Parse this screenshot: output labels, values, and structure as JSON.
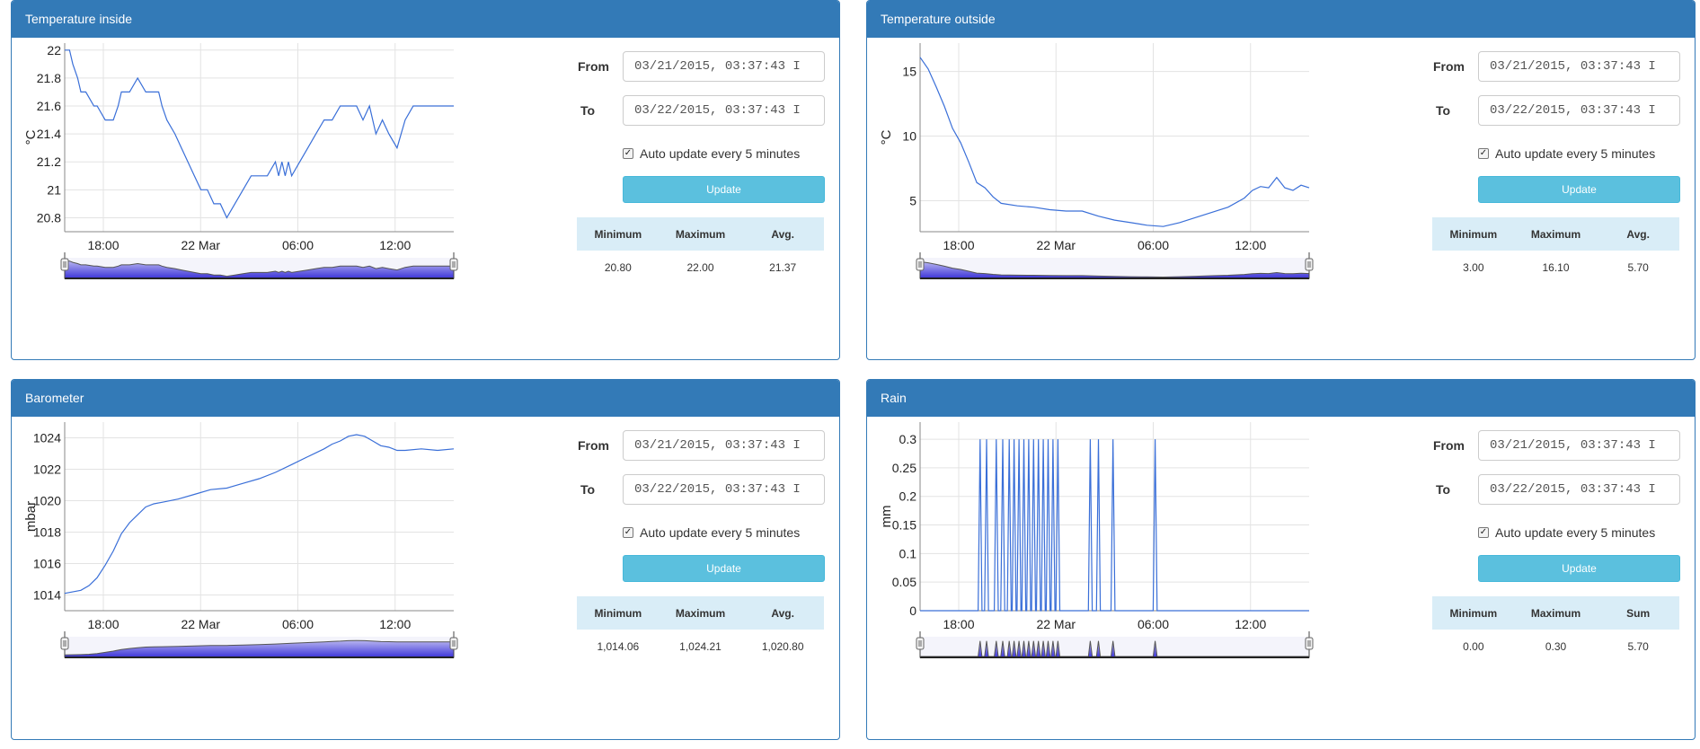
{
  "panels": [
    {
      "title": "Temperature inside",
      "ylabel": "°C",
      "yticks": [
        "22",
        "21.8",
        "21.6",
        "21.4",
        "21.2",
        "21",
        "20.8"
      ],
      "xticks": [
        "18:00",
        "22 Mar",
        "06:00",
        "12:00"
      ],
      "from_label": "From",
      "from_value": "03/21/2015, 03:37:43 I",
      "to_label": "To",
      "to_value": "03/22/2015, 03:37:43 I",
      "auto_update_label": "Auto update every 5 minutes",
      "update_label": "Update",
      "stats_headers": [
        "Minimum",
        "Maximum",
        "Avg."
      ],
      "stats_values": [
        "20.80",
        "22.00",
        "21.37"
      ]
    },
    {
      "title": "Temperature outside",
      "ylabel": "°C",
      "yticks": [
        "15",
        "10",
        "5"
      ],
      "xticks": [
        "18:00",
        "22 Mar",
        "06:00",
        "12:00"
      ],
      "from_label": "From",
      "from_value": "03/21/2015, 03:37:43 I",
      "to_label": "To",
      "to_value": "03/22/2015, 03:37:43 I",
      "auto_update_label": "Auto update every 5 minutes",
      "update_label": "Update",
      "stats_headers": [
        "Minimum",
        "Maximum",
        "Avg."
      ],
      "stats_values": [
        "3.00",
        "16.10",
        "5.70"
      ]
    },
    {
      "title": "Barometer",
      "ylabel": "mbar",
      "yticks": [
        "1024",
        "1022",
        "1020",
        "1018",
        "1016",
        "1014"
      ],
      "xticks": [
        "18:00",
        "22 Mar",
        "06:00",
        "12:00"
      ],
      "from_label": "From",
      "from_value": "03/21/2015, 03:37:43 I",
      "to_label": "To",
      "to_value": "03/22/2015, 03:37:43 I",
      "auto_update_label": "Auto update every 5 minutes",
      "update_label": "Update",
      "stats_headers": [
        "Minimum",
        "Maximum",
        "Avg."
      ],
      "stats_values": [
        "1,014.06",
        "1,024.21",
        "1,020.80"
      ]
    },
    {
      "title": "Rain",
      "ylabel": "mm",
      "yticks": [
        "0.3",
        "0.25",
        "0.2",
        "0.15",
        "0.1",
        "0.05",
        "0"
      ],
      "xticks": [
        "18:00",
        "22 Mar",
        "06:00",
        "12:00"
      ],
      "from_label": "From",
      "from_value": "03/21/2015, 03:37:43 I",
      "to_label": "To",
      "to_value": "03/22/2015, 03:37:43 I",
      "auto_update_label": "Auto update every 5 minutes",
      "update_label": "Update",
      "stats_headers": [
        "Minimum",
        "Maximum",
        "Sum"
      ],
      "stats_values": [
        "0.00",
        "0.30",
        "5.70"
      ]
    }
  ],
  "colors": {
    "panel_header": "#337ab7",
    "series_line": "#3a6fd8",
    "navigator_fill_top": "#b7b4f0",
    "navigator_fill_bottom": "#3c34d8",
    "update_button": "#5bc0de",
    "stats_header": "#d9edf7"
  },
  "chart_data": [
    {
      "type": "line",
      "title": "Temperature inside",
      "ylabel": "°C",
      "x_range": [
        "2015-03-21T15:37",
        "2015-03-22T15:37"
      ],
      "ylim": [
        20.7,
        22.05
      ],
      "x_ticks": [
        "18:00",
        "22 Mar",
        "06:00",
        "12:00"
      ],
      "x": [
        0,
        0.3,
        0.5,
        0.8,
        1,
        1.3,
        1.8,
        2,
        2.5,
        3,
        3.3,
        3.5,
        4,
        4.5,
        5,
        5.5,
        5.8,
        6,
        6.3,
        6.8,
        7.2,
        7.6,
        8,
        8.4,
        8.8,
        9.2,
        9.6,
        10,
        10.5,
        11,
        11.5,
        12,
        12.5,
        13,
        13.2,
        13.4,
        13.6,
        13.8,
        14,
        14.5,
        15,
        15.5,
        16,
        16.5,
        17,
        17.5,
        18,
        18.4,
        18.8,
        19.2,
        19.6,
        20,
        20.5,
        21,
        21.5,
        22,
        22.5,
        23,
        23.5,
        24
      ],
      "y": [
        22.0,
        22.0,
        21.9,
        21.8,
        21.7,
        21.7,
        21.6,
        21.6,
        21.5,
        21.5,
        21.6,
        21.7,
        21.7,
        21.8,
        21.7,
        21.7,
        21.7,
        21.6,
        21.5,
        21.4,
        21.3,
        21.2,
        21.1,
        21.0,
        21.0,
        20.9,
        20.9,
        20.8,
        20.9,
        21.0,
        21.1,
        21.1,
        21.1,
        21.2,
        21.1,
        21.2,
        21.1,
        21.2,
        21.1,
        21.2,
        21.3,
        21.4,
        21.5,
        21.5,
        21.6,
        21.6,
        21.6,
        21.5,
        21.6,
        21.4,
        21.5,
        21.4,
        21.3,
        21.5,
        21.6,
        21.6,
        21.6,
        21.6,
        21.6,
        21.6
      ],
      "x_unit": "hours since 2015-03-21 15:37"
    },
    {
      "type": "line",
      "title": "Temperature outside",
      "ylabel": "°C",
      "x_range": [
        "2015-03-21T15:37",
        "2015-03-22T15:37"
      ],
      "ylim": [
        2.6,
        17.2
      ],
      "x_ticks": [
        "18:00",
        "22 Mar",
        "06:00",
        "12:00"
      ],
      "x": [
        0,
        0.5,
        1,
        1.5,
        2,
        2.5,
        3,
        3.5,
        4,
        4.5,
        5,
        6,
        7,
        8,
        9,
        10,
        11,
        12,
        13,
        14,
        15,
        16,
        17,
        18,
        19,
        20,
        20.5,
        21,
        21.5,
        22,
        22.5,
        23,
        23.5,
        24
      ],
      "y": [
        16.1,
        15.2,
        13.8,
        12.3,
        10.6,
        9.5,
        8.0,
        6.4,
        6.0,
        5.3,
        4.8,
        4.6,
        4.5,
        4.3,
        4.2,
        4.2,
        3.8,
        3.5,
        3.3,
        3.1,
        3.0,
        3.3,
        3.7,
        4.1,
        4.5,
        5.2,
        5.8,
        6.1,
        6.0,
        6.8,
        6.0,
        5.8,
        6.2,
        6.0
      ],
      "x_unit": "hours since 2015-03-21 15:37"
    },
    {
      "type": "line",
      "title": "Barometer",
      "ylabel": "mbar",
      "x_range": [
        "2015-03-21T15:37",
        "2015-03-22T15:37"
      ],
      "ylim": [
        1013.0,
        1025.0
      ],
      "x_ticks": [
        "18:00",
        "22 Mar",
        "06:00",
        "12:00"
      ],
      "x": [
        0,
        1,
        1.5,
        2,
        2.5,
        3,
        3.5,
        4,
        4.5,
        5,
        5.5,
        6,
        7,
        8,
        9,
        10,
        11,
        12,
        13,
        14,
        15,
        16,
        16.5,
        17,
        17.5,
        18,
        18.5,
        19,
        19.5,
        20,
        20.5,
        21,
        22,
        23,
        24
      ],
      "y": [
        1014.1,
        1014.3,
        1014.6,
        1015.1,
        1015.9,
        1016.8,
        1017.9,
        1018.6,
        1019.1,
        1019.6,
        1019.8,
        1019.9,
        1020.1,
        1020.4,
        1020.7,
        1020.8,
        1021.1,
        1021.4,
        1021.8,
        1022.3,
        1022.8,
        1023.3,
        1023.6,
        1023.8,
        1024.1,
        1024.2,
        1024.1,
        1023.8,
        1023.5,
        1023.4,
        1023.2,
        1023.2,
        1023.3,
        1023.2,
        1023.3
      ],
      "x_unit": "hours since 2015-03-21 15:37"
    },
    {
      "type": "line",
      "title": "Rain",
      "ylabel": "mm",
      "x_range": [
        "2015-03-21T15:37",
        "2015-03-22T15:37"
      ],
      "ylim": [
        0,
        0.33
      ],
      "x_ticks": [
        "18:00",
        "22 Mar",
        "06:00",
        "12:00"
      ],
      "spikes_x": [
        3.7,
        4.1,
        4.7,
        5.1,
        5.5,
        5.8,
        6.1,
        6.4,
        6.7,
        7.0,
        7.3,
        7.6,
        7.9,
        8.2,
        8.5,
        10.5,
        11.0,
        11.9,
        14.5
      ],
      "spike_value": 0.3,
      "x_unit": "hours since 2015-03-21 15:37"
    }
  ]
}
